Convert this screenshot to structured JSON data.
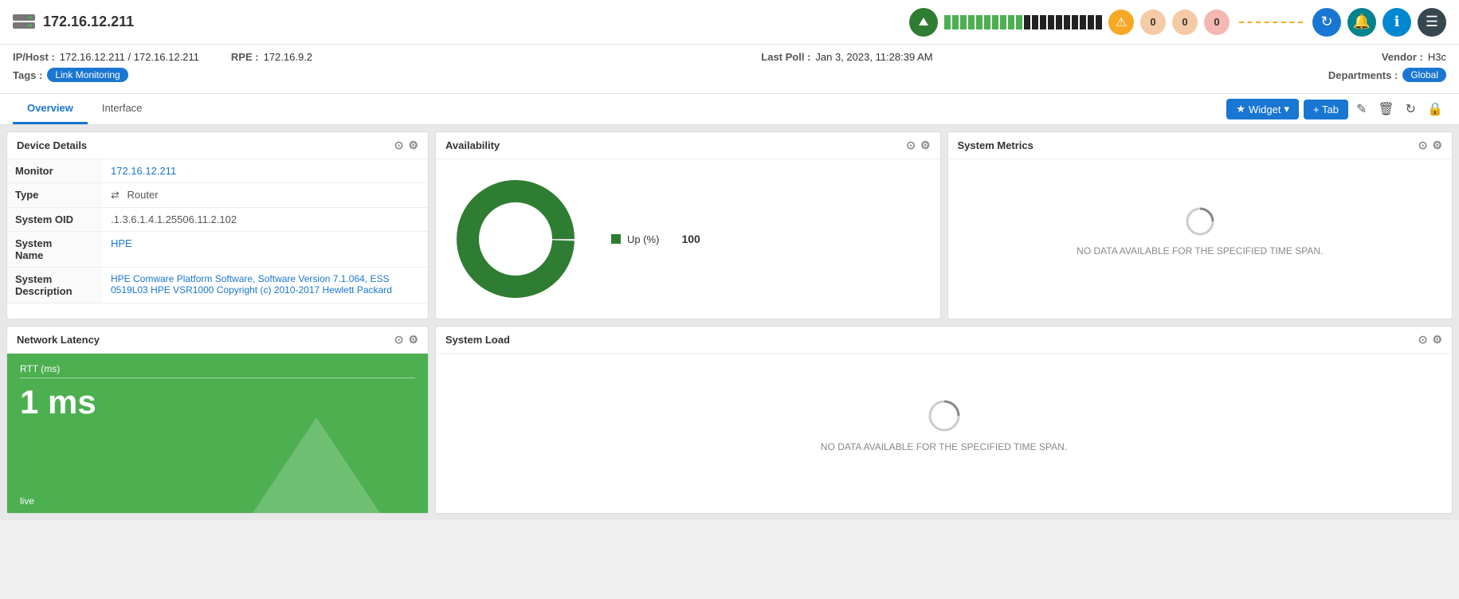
{
  "header": {
    "server_icon": "server",
    "ip_address": "172.16.12.211",
    "bandwidth_bars_green": 10,
    "bandwidth_bars_black": 10,
    "alert_badge": "⚠",
    "badge1_value": "0",
    "badge2_value": "0",
    "badge3_value": "0",
    "refresh_icon": "↻",
    "bell_icon": "🔔",
    "info_icon": "ℹ",
    "menu_icon": "☰"
  },
  "info_bar": {
    "ip_host_label": "IP/Host :",
    "ip_host_value": "172.16.12.211 / 172.16.12.211",
    "rpe_label": "RPE :",
    "rpe_value": "172.16.9.2",
    "last_poll_label": "Last Poll :",
    "last_poll_value": "Jan 3, 2023, 11:28:39 AM",
    "vendor_label": "Vendor :",
    "vendor_value": "H3c",
    "tags_label": "Tags :",
    "tags_value": "Link Monitoring",
    "departments_label": "Departments :",
    "departments_value": "Global"
  },
  "tabs": {
    "overview_label": "Overview",
    "interface_label": "Interface",
    "widget_label": "Widget",
    "tab_label": "+ Tab"
  },
  "device_details": {
    "title": "Device Details",
    "monitor_label": "Monitor",
    "monitor_value": "172.16.12.211",
    "type_label": "Type",
    "type_value": "Router",
    "system_oid_label": "System OID",
    "system_oid_value": ".1.3.6.1.4.1.25506.11.2.102",
    "system_name_label": "System Name",
    "system_name_value": "HPE",
    "system_desc_label": "System Description",
    "system_desc_value": "HPE Comware Platform Software, Software Version 7.1.064, ESS 0519L03 HPE VSR1000 Copyright (c) 2010-2017 Hewlett Packard"
  },
  "availability": {
    "title": "Availability",
    "legend_label": "Up (%)",
    "legend_value": "100",
    "donut_color": "#2e7d32",
    "donut_bg": "#fff"
  },
  "system_metrics": {
    "title": "System Metrics",
    "no_data_text": "NO DATA AVAILABLE FOR THE SPECIFIED TIME SPAN."
  },
  "network_latency": {
    "title": "Network Latency",
    "rtt_label": "RTT (ms)",
    "rtt_value": "1 ms",
    "live_label": "live"
  },
  "system_load": {
    "title": "System Load",
    "no_data_text": "NO DATA AVAILABLE FOR THE SPECIFIED TIME SPAN."
  }
}
